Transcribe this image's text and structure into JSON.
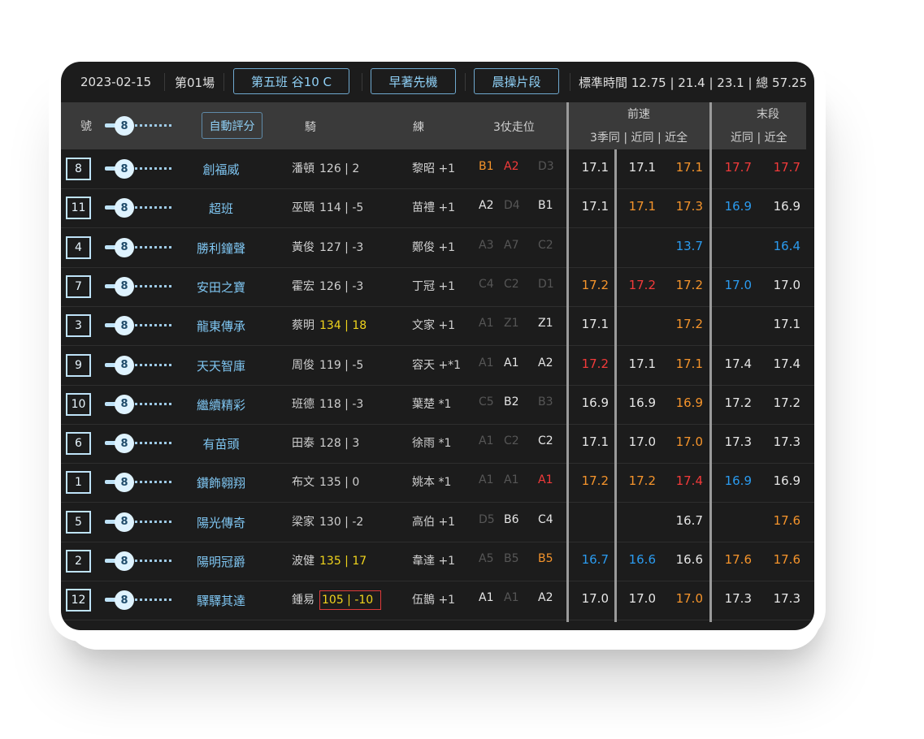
{
  "topbar": {
    "date": "2023-02-15",
    "race": "第01場",
    "class": "第五班 谷10 C",
    "mode": "早著先機",
    "session": "晨操片段",
    "standard": "標準時間 12.75 | 21.4 | 23.1 | 總 57.25"
  },
  "header": {
    "num": "號",
    "auto_score": "自動評分",
    "jockey": "騎",
    "trainer": "練",
    "position": "3仗走位",
    "front": "前速",
    "front_sub": "3季同 | 近同 | 近全",
    "end": "末段",
    "end_sub": "近同 | 近全"
  },
  "slider_value": "8",
  "colors": {
    "white": "#e6e6e6",
    "orange": "#f5942b",
    "red": "#f23a3a",
    "blue": "#2b9bef",
    "dim": "#565656",
    "yellow": "#f0d41c",
    "name": "#7fc6f2"
  },
  "rows": [
    {
      "num": "8",
      "name": "創福威",
      "jockey": "潘頓",
      "weight": "126 | 2",
      "wcolor": "n",
      "trainer": "黎昭 +1",
      "pos": [
        [
          "B1",
          "orange"
        ],
        [
          "A2",
          "red"
        ],
        [
          "D3",
          "dim"
        ]
      ],
      "front": [
        [
          "17.1",
          "white"
        ],
        [
          "17.1",
          "white"
        ],
        [
          "17.1",
          "orange"
        ]
      ],
      "end": [
        [
          "17.7",
          "red"
        ],
        [
          "17.7",
          "red"
        ]
      ]
    },
    {
      "num": "11",
      "name": "超班",
      "jockey": "巫頤",
      "weight": "114 | -5",
      "wcolor": "n",
      "trainer": "苗禮 +1",
      "pos": [
        [
          "A2",
          "white"
        ],
        [
          "D4",
          "dim"
        ],
        [
          "B1",
          "white"
        ]
      ],
      "front": [
        [
          "17.1",
          "white"
        ],
        [
          "17.1",
          "orange"
        ],
        [
          "17.3",
          "orange"
        ]
      ],
      "end": [
        [
          "16.9",
          "blue"
        ],
        [
          "16.9",
          "white"
        ]
      ]
    },
    {
      "num": "4",
      "name": "勝利鐘聲",
      "jockey": "黃俊",
      "weight": "127 | -3",
      "wcolor": "n",
      "trainer": "鄭俊 +1",
      "pos": [
        [
          "A3",
          "dim"
        ],
        [
          "A7",
          "dim"
        ],
        [
          "C2",
          "dim"
        ]
      ],
      "front": [
        [
          "",
          ""
        ],
        [
          "",
          ""
        ],
        [
          "13.7",
          "blue"
        ]
      ],
      "end": [
        [
          "",
          ""
        ],
        [
          "16.4",
          "blue"
        ]
      ]
    },
    {
      "num": "7",
      "name": "安田之寶",
      "jockey": "霍宏",
      "weight": "126 | -3",
      "wcolor": "n",
      "trainer": "丁冠 +1",
      "pos": [
        [
          "C4",
          "dim"
        ],
        [
          "C2",
          "dim"
        ],
        [
          "D1",
          "dim"
        ]
      ],
      "front": [
        [
          "17.2",
          "orange"
        ],
        [
          "17.2",
          "red"
        ],
        [
          "17.2",
          "orange"
        ]
      ],
      "end": [
        [
          "17.0",
          "blue"
        ],
        [
          "17.0",
          "white"
        ]
      ]
    },
    {
      "num": "3",
      "name": "龍東傳承",
      "jockey": "蔡明",
      "weight": "134 | 18",
      "wcolor": "y",
      "trainer": "文家 +1",
      "pos": [
        [
          "A1",
          "dim"
        ],
        [
          "Z1",
          "dim"
        ],
        [
          "Z1",
          "white"
        ]
      ],
      "front": [
        [
          "17.1",
          "white"
        ],
        [
          "",
          ""
        ],
        [
          "17.2",
          "orange"
        ]
      ],
      "end": [
        [
          "",
          ""
        ],
        [
          "17.1",
          "white"
        ]
      ]
    },
    {
      "num": "9",
      "name": "天天智庫",
      "jockey": "周俊",
      "weight": "119 | -5",
      "wcolor": "n",
      "trainer": "容天 +*1",
      "pos": [
        [
          "A1",
          "dim"
        ],
        [
          "A1",
          "white"
        ],
        [
          "A2",
          "white"
        ]
      ],
      "front": [
        [
          "17.2",
          "red"
        ],
        [
          "17.1",
          "white"
        ],
        [
          "17.1",
          "orange"
        ]
      ],
      "end": [
        [
          "17.4",
          "white"
        ],
        [
          "17.4",
          "white"
        ]
      ]
    },
    {
      "num": "10",
      "name": "繼續精彩",
      "jockey": "班德",
      "weight": "118 | -3",
      "wcolor": "n",
      "trainer": "葉楚 *1",
      "pos": [
        [
          "C5",
          "dim"
        ],
        [
          "B2",
          "white"
        ],
        [
          "B3",
          "dim"
        ]
      ],
      "front": [
        [
          "16.9",
          "white"
        ],
        [
          "16.9",
          "white"
        ],
        [
          "16.9",
          "orange"
        ]
      ],
      "end": [
        [
          "17.2",
          "white"
        ],
        [
          "17.2",
          "white"
        ]
      ]
    },
    {
      "num": "6",
      "name": "有苗頭",
      "jockey": "田泰",
      "weight": "128 | 3",
      "wcolor": "n",
      "trainer": "徐雨 *1",
      "pos": [
        [
          "A1",
          "dim"
        ],
        [
          "C2",
          "dim"
        ],
        [
          "C2",
          "white"
        ]
      ],
      "front": [
        [
          "17.1",
          "white"
        ],
        [
          "17.0",
          "white"
        ],
        [
          "17.0",
          "orange"
        ]
      ],
      "end": [
        [
          "17.3",
          "white"
        ],
        [
          "17.3",
          "white"
        ]
      ]
    },
    {
      "num": "1",
      "name": "鑽飾翱翔",
      "jockey": "布文",
      "weight": "135 | 0",
      "wcolor": "n",
      "trainer": "姚本 *1",
      "pos": [
        [
          "A1",
          "dim"
        ],
        [
          "A1",
          "dim"
        ],
        [
          "A1",
          "red"
        ]
      ],
      "front": [
        [
          "17.2",
          "orange"
        ],
        [
          "17.2",
          "orange"
        ],
        [
          "17.4",
          "red"
        ]
      ],
      "end": [
        [
          "16.9",
          "blue"
        ],
        [
          "16.9",
          "white"
        ]
      ]
    },
    {
      "num": "5",
      "name": "陽光傳奇",
      "jockey": "梁家",
      "weight": "130 | -2",
      "wcolor": "n",
      "trainer": "高伯 +1",
      "pos": [
        [
          "D5",
          "dim"
        ],
        [
          "B6",
          "white"
        ],
        [
          "C4",
          "white"
        ]
      ],
      "front": [
        [
          "",
          ""
        ],
        [
          "",
          ""
        ],
        [
          "16.7",
          "white"
        ]
      ],
      "end": [
        [
          "",
          ""
        ],
        [
          "17.6",
          "orange"
        ]
      ]
    },
    {
      "num": "2",
      "name": "陽明冠爵",
      "jockey": "波健",
      "weight": "135 | 17",
      "wcolor": "y",
      "trainer": "韋達 +1",
      "pos": [
        [
          "A5",
          "dim"
        ],
        [
          "B5",
          "dim"
        ],
        [
          "B5",
          "orange"
        ]
      ],
      "front": [
        [
          "16.7",
          "blue"
        ],
        [
          "16.6",
          "blue"
        ],
        [
          "16.6",
          "white"
        ]
      ],
      "end": [
        [
          "17.6",
          "orange"
        ],
        [
          "17.6",
          "orange"
        ]
      ]
    },
    {
      "num": "12",
      "name": "驛驛其達",
      "jockey": "鍾易",
      "weight": "105 | -10",
      "wcolor": "box",
      "trainer": "伍鵲 +1",
      "pos": [
        [
          "A1",
          "white"
        ],
        [
          "A1",
          "dim"
        ],
        [
          "A2",
          "white"
        ]
      ],
      "front": [
        [
          "17.0",
          "white"
        ],
        [
          "17.0",
          "white"
        ],
        [
          "17.0",
          "orange"
        ]
      ],
      "end": [
        [
          "17.3",
          "white"
        ],
        [
          "17.3",
          "white"
        ]
      ]
    }
  ]
}
